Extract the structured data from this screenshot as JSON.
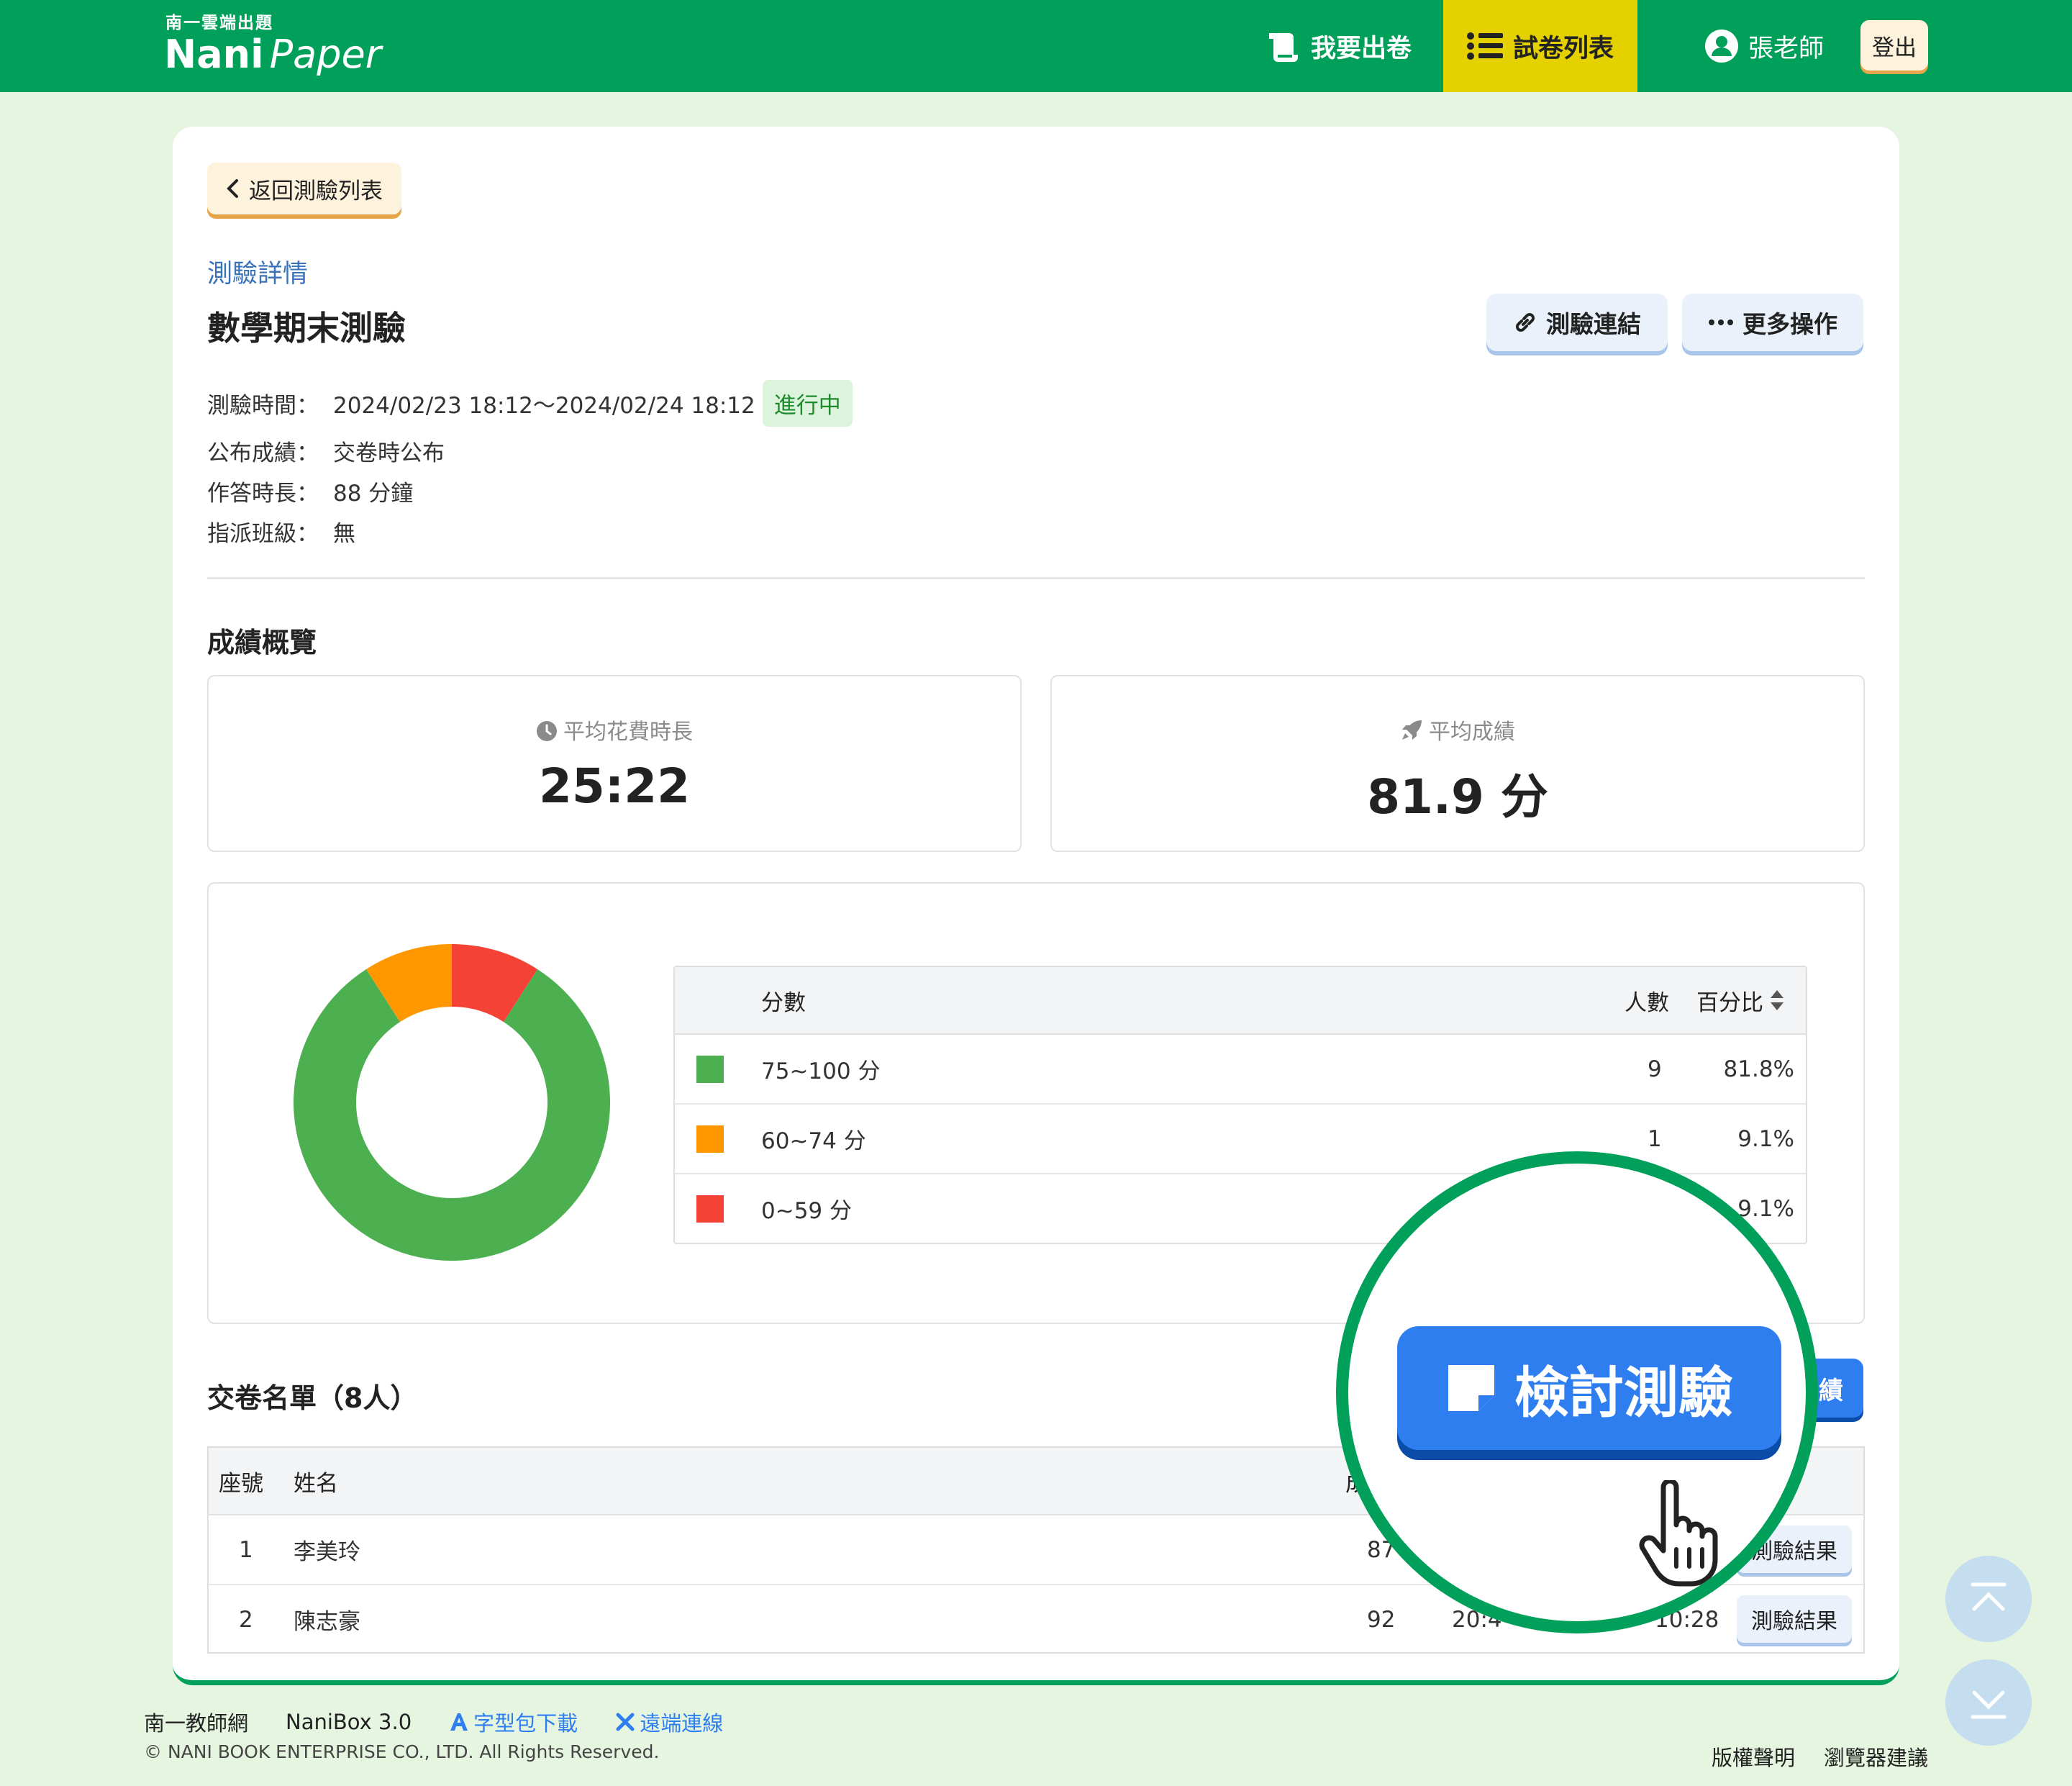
{
  "header": {
    "brand_sub": "南一雲端出題",
    "brand_main": "Nani",
    "brand_script": "Paper",
    "nav_make": "我要出卷",
    "nav_list": "試卷列表",
    "user": "張老師",
    "logout": "登出",
    "colors": {
      "bar": "#00a05a",
      "active": "#e5d100"
    }
  },
  "page": {
    "back": "返回測驗列表",
    "breadcrumb": "測驗詳情",
    "title": "數學期末測驗",
    "link_btn": "測驗連結",
    "more_btn": "更多操作",
    "info": {
      "time_label": "測驗時間：",
      "time_value": "2024/02/23 18:12～2024/02/24 18:12",
      "status": "進行中",
      "publish_label": "公布成績：",
      "publish_value": "交卷時公布",
      "duration_label": "作答時長：",
      "duration_value": "88 分鐘",
      "class_label": "指派班級：",
      "class_value": "無"
    }
  },
  "overview": {
    "title": "成績概覽",
    "avg_time_label": "平均花費時長",
    "avg_time_value": "25:22",
    "avg_score_label": "平均成績",
    "avg_score_value": "81.9 分"
  },
  "distribution": {
    "col_score": "分數",
    "col_count": "人數",
    "col_pct": "百分比",
    "rows": [
      {
        "range": "75~100 分",
        "count": "9",
        "pct": "81.8%",
        "color": "#4caf50"
      },
      {
        "range": "60~74 分",
        "count": "1",
        "pct": "9.1%",
        "color": "#ff9800"
      },
      {
        "range": "0~59 分",
        "count": "",
        "pct": "9.1%",
        "color": "#f44336"
      }
    ]
  },
  "chart_data": {
    "type": "pie",
    "categories": [
      "75~100 分",
      "60~74 分",
      "0~59 分"
    ],
    "values": [
      81.8,
      9.1,
      9.1
    ],
    "colors": [
      "#4caf50",
      "#ff9800",
      "#f44336"
    ]
  },
  "submissions": {
    "title": "交卷名單（8人）",
    "publish_btn_fragment": "績",
    "col_seat": "座號",
    "col_name": "姓名",
    "col_partial": "成",
    "rows": [
      {
        "seat": "1",
        "name": "李美玲",
        "score": "87",
        "time": "",
        "date": "",
        "result": "測驗結果"
      },
      {
        "seat": "2",
        "name": "陳志豪",
        "score": "92",
        "time": "20:4",
        "date": "10:28",
        "result": "測驗結果"
      }
    ]
  },
  "zoom": {
    "review_btn": "檢討測驗"
  },
  "footer": {
    "link1": "南一教師網",
    "link2": "NaniBox 3.0",
    "link3": "字型包下載",
    "link4": "遠端連線",
    "copyright": "© NANI BOOK ENTERPRISE CO., LTD. All Rights Reserved.",
    "right1": "版權聲明",
    "right2": "瀏覽器建議"
  }
}
